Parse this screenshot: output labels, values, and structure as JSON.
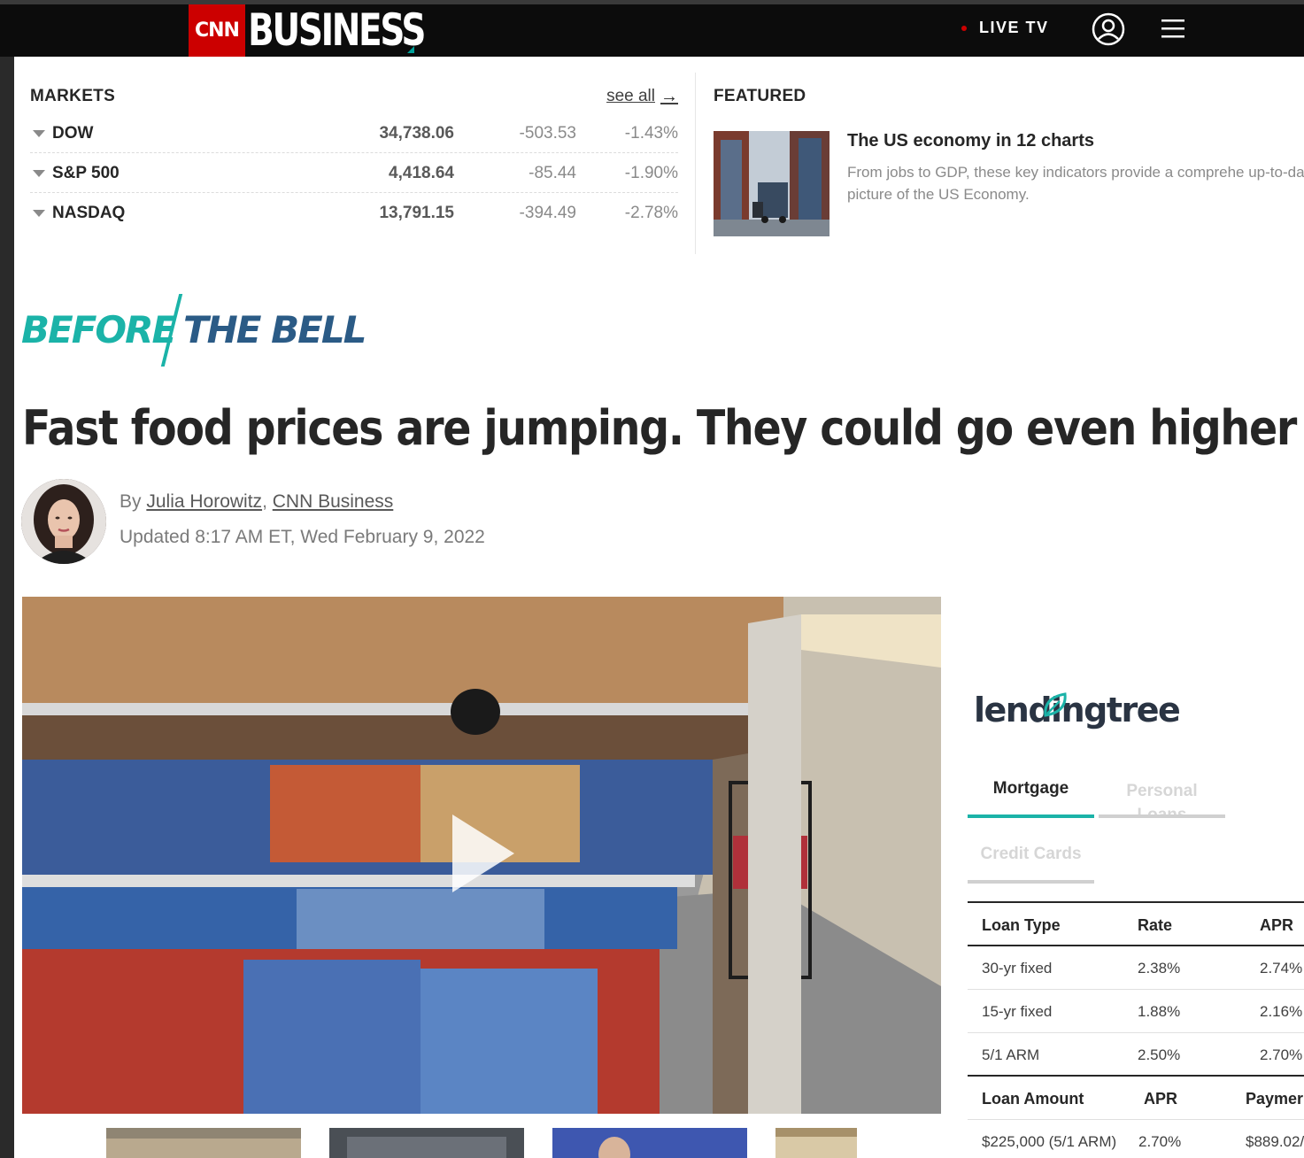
{
  "header": {
    "logo_cnn": "CNN",
    "logo_business": "BUSINESS",
    "live_tv": "LIVE TV"
  },
  "markets": {
    "title": "MARKETS",
    "see_all": "see all",
    "rows": [
      {
        "name": "DOW",
        "value": "34,738.06",
        "change": "-503.53",
        "pct": "-1.43%"
      },
      {
        "name": "S&P 500",
        "value": "4,418.64",
        "change": "-85.44",
        "pct": "-1.90%"
      },
      {
        "name": "NASDAQ",
        "value": "13,791.15",
        "change": "-394.49",
        "pct": "-2.78%"
      }
    ]
  },
  "featured": {
    "title": "FEATURED",
    "headline": "The US economy in 12 charts",
    "description": "From jobs to GDP, these key indicators provide a comprehe up-to-date picture of the US Economy."
  },
  "section": {
    "before": "BEFORE",
    "bell": "THE BELL"
  },
  "article": {
    "headline": "Fast food prices are jumping. They could go even higher",
    "by": "By ",
    "author": "Julia Horowitz",
    "sep": ", ",
    "outlet": "CNN Business",
    "updated": "Updated 8:17 AM ET, Wed February 9, 2022"
  },
  "lendingtree": {
    "logo": "lendingtree",
    "tabs": {
      "mortgage": "Mortgage",
      "personal": "Personal Loans",
      "credit": "Credit Cards"
    },
    "loan_head": {
      "c1": "Loan Type",
      "c2": "Rate",
      "c3": "APR"
    },
    "loans": [
      {
        "type": "30-yr fixed",
        "rate": "2.38%",
        "apr": "2.74%"
      },
      {
        "type": "15-yr fixed",
        "rate": "1.88%",
        "apr": "2.16%"
      },
      {
        "type": "5/1 ARM",
        "rate": "2.50%",
        "apr": "2.70%"
      }
    ],
    "amount_head": {
      "c1": "Loan Amount",
      "c2": "APR",
      "c3": "Paymer"
    },
    "amounts": [
      {
        "amount": "$225,000 (5/1 ARM)",
        "apr": "2.70%",
        "payment": "$889.02/"
      }
    ]
  },
  "colors": {
    "brand_red": "#cc0000",
    "teal": "#1bb3a8",
    "navy": "#2b5b86"
  }
}
